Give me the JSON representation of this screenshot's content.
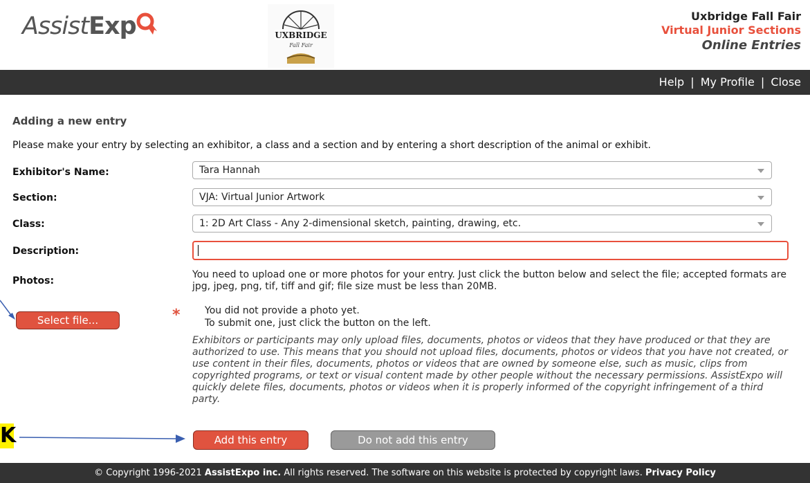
{
  "header": {
    "brand_assist": "Assist",
    "brand_expo": "Exp",
    "fair_logo_text": "UXBRIDGE",
    "fair_logo_sub": "Fall Fair",
    "line1": "Uxbridge Fall Fair",
    "line2": "Virtual Junior Sections",
    "line3": "Online Entries"
  },
  "nav": {
    "help": "Help",
    "sep1": "|",
    "my_profile": "My Profile",
    "sep2": "|",
    "close": "Close"
  },
  "form": {
    "title": "Adding a new entry",
    "intro": "Please make your entry by selecting an exhibitor, a class and a section and by entering a short description of the animal or exhibit.",
    "exhibitor_label": "Exhibitor's Name:",
    "exhibitor_value": "Tara Hannah",
    "section_label": "Section:",
    "section_value": "VJA: Virtual Junior Artwork",
    "class_label": "Class:",
    "class_value": "1: 2D Art Class - Any 2-dimensional sketch, painting, drawing, etc.",
    "description_label": "Description:",
    "description_value": "",
    "photos_label": "Photos:",
    "photos_help": "You need to upload one or more photos for your entry. Just click the button below and select the file; accepted formats are jpg, jpeg, png, tif, tiff and gif; file size must be less than 20MB.",
    "select_file_label": "Select file...",
    "required_mark": "*",
    "photo_status_line1": "You did not provide a photo yet.",
    "photo_status_line2": "To submit one, just click the button on the left.",
    "disclaimer": "Exhibitors or participants may only upload files, documents, photos or videos that they have produced or that they are authorized to use. This means that you should not upload files, documents, photos or videos that you have not created, or use content in their files, documents, photos or videos that are owned by someone else, such as music, clips from copyrighted programs, or text or visual content made by other people without the necessary permissions. AssistExpo will quickly delete files, documents, photos or videos when it is properly informed of the copyright infringement of a third party.",
    "add_label": "Add this entry",
    "no_add_label": "Do not add this entry"
  },
  "annotation": {
    "highlight_text": "K"
  },
  "footer": {
    "prefix": "© Copyright 1996-2021 ",
    "company": "AssistExpo inc.",
    "middle": " All rights reserved. The software on this website is protected by copyright laws. ",
    "privacy": "Privacy Policy"
  },
  "colors": {
    "accent": "#e0533f",
    "dark_bar": "#333333",
    "secondary_button": "#9a9a9a"
  }
}
